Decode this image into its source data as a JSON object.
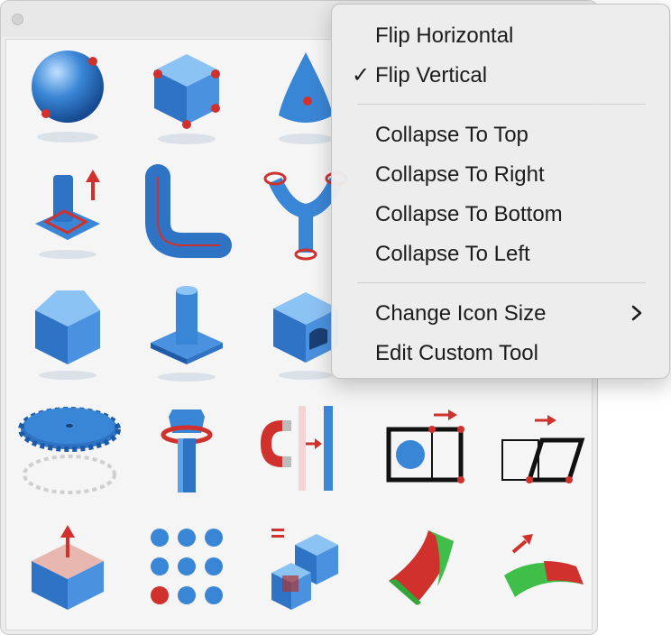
{
  "window": {
    "tools": [
      {
        "name": "sphere-points-icon"
      },
      {
        "name": "cube-points-icon"
      },
      {
        "name": "cone-point-icon"
      },
      {
        "name": "extrude-arrow-icon"
      },
      {
        "name": "pipe-path-icon"
      },
      {
        "name": "y-branch-icon"
      },
      {
        "name": "chamfer-block-icon"
      },
      {
        "name": "boss-plate-icon"
      },
      {
        "name": "block-cutout-icon"
      },
      {
        "name": "gear-icon"
      },
      {
        "name": "bolt-icon"
      },
      {
        "name": "magnet-align-icon"
      },
      {
        "name": "frame-sphere-icon"
      },
      {
        "name": "skew-frame-icon"
      },
      {
        "name": "push-face-icon"
      },
      {
        "name": "sphere-array-icon"
      },
      {
        "name": "boolean-cubes-icon"
      },
      {
        "name": "curved-surface-icon"
      },
      {
        "name": "surface-arrow-icon"
      }
    ]
  },
  "context_menu": {
    "flip_horizontal": "Flip Horizontal",
    "flip_vertical": "Flip Vertical",
    "flip_vertical_check": "✓",
    "collapse_top": "Collapse To Top",
    "collapse_right": "Collapse To Right",
    "collapse_bottom": "Collapse To Bottom",
    "collapse_left": "Collapse To Left",
    "change_icon_size": "Change Icon Size",
    "edit_custom_tool": "Edit Custom Tool",
    "submenu_icon": "chevron-right-icon"
  },
  "colors": {
    "tool_blue": "#3a86d6",
    "tool_blue_dark": "#1e5aa8",
    "tool_red": "#d0312d",
    "tool_green": "#3fbf4a"
  }
}
